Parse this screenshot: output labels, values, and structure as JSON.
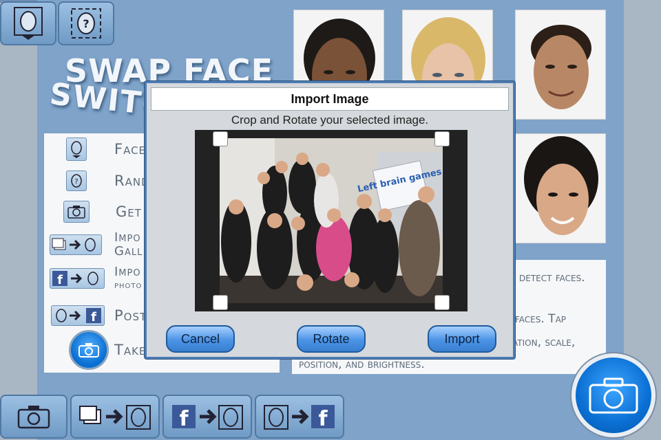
{
  "logo": {
    "line1": "SWAP FACE",
    "line2": "SWITCH"
  },
  "menu": {
    "items": [
      {
        "label": "Face",
        "icon": "face-icon"
      },
      {
        "label": "Rand",
        "icon": "random-face-icon"
      },
      {
        "label": "Get",
        "icon": "camera-icon"
      },
      {
        "label": "Impo",
        "label2": "Gall",
        "icon": "gallery-to-face-icon"
      },
      {
        "label": "Impo",
        "label2": "photo",
        "icon": "facebook-to-face-icon"
      },
      {
        "label": "Post",
        "icon": "face-to-facebook-icon"
      },
      {
        "label": "Take",
        "icon": "camera-icon"
      }
    ]
  },
  "info": {
    "line1": "detect faces.",
    "line2": "faces. Tap",
    "line3": "ation, scale,",
    "line4": "position, and brightness."
  },
  "dialog": {
    "title": "Import Image",
    "subtitle": "Crop and Rotate your selected image.",
    "cancel": "Cancel",
    "rotate": "Rotate",
    "import": "Import",
    "poster_text": "Left brain games"
  },
  "colors": {
    "panel": "#7fa3c9",
    "accent": "#4d7cb4",
    "button": "#4b93e6"
  }
}
